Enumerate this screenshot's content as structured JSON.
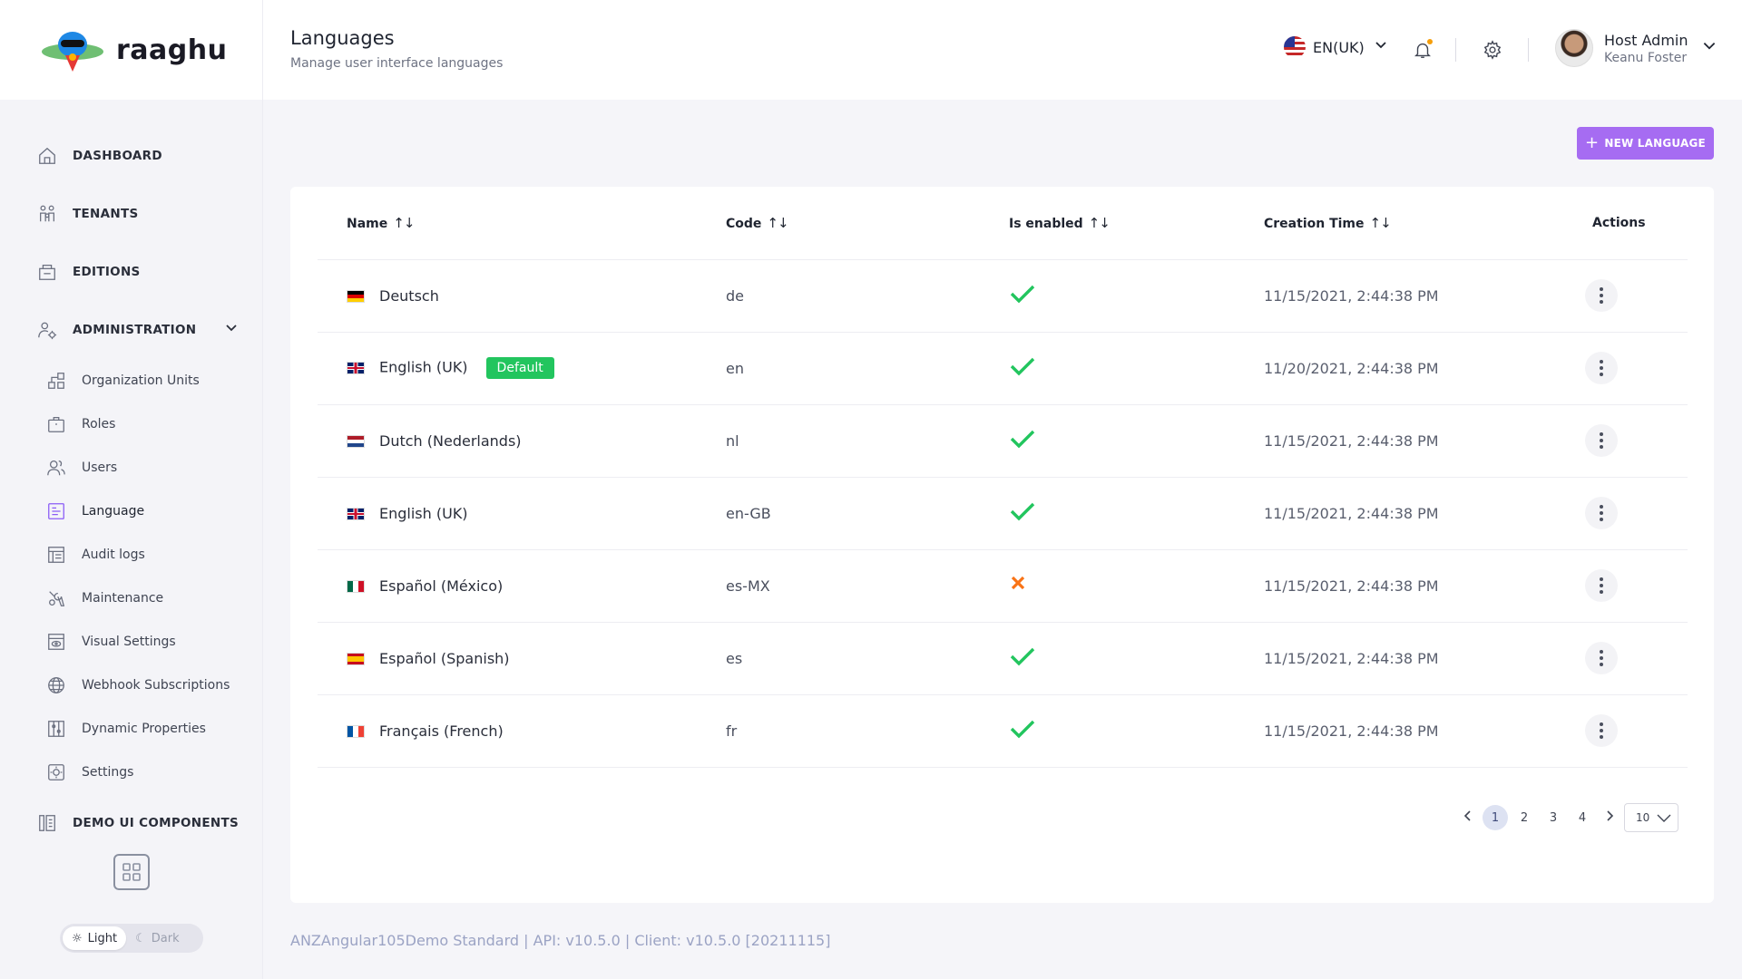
{
  "brand": {
    "name": "raaghu"
  },
  "sidebar": {
    "main": [
      {
        "label": "DASHBOARD",
        "icon": "home-icon"
      },
      {
        "label": "TENANTS",
        "icon": "tenants-icon"
      },
      {
        "label": "EDITIONS",
        "icon": "editions-icon"
      }
    ],
    "admin": {
      "label": "ADMINISTRATION",
      "icon": "admin-icon"
    },
    "sub": [
      {
        "label": "Organization Units",
        "icon": "org-units-icon"
      },
      {
        "label": "Roles",
        "icon": "roles-icon"
      },
      {
        "label": "Users",
        "icon": "users-icon"
      },
      {
        "label": "Language",
        "icon": "language-icon",
        "active": true
      },
      {
        "label": "Audit logs",
        "icon": "audit-logs-icon"
      },
      {
        "label": "Maintenance",
        "icon": "maintenance-icon"
      },
      {
        "label": "Visual Settings",
        "icon": "visual-settings-icon"
      },
      {
        "label": "Webhook Subscriptions",
        "icon": "globe-icon"
      },
      {
        "label": "Dynamic Properties",
        "icon": "dynamic-properties-icon"
      },
      {
        "label": "Settings",
        "icon": "settings-icon"
      }
    ],
    "demo": {
      "label": "DEMO UI COMPONENTS",
      "icon": "components-icon"
    },
    "theme": {
      "light": "Light",
      "dark": "Dark"
    }
  },
  "header": {
    "title": "Languages",
    "subtitle": "Manage user interface languages",
    "language": "EN(UK)",
    "user": {
      "name": "Host Admin",
      "sub": "Keanu Foster"
    }
  },
  "toolbar": {
    "new_language": "NEW LANGUAGE"
  },
  "table": {
    "columns": {
      "name": "Name",
      "code": "Code",
      "enabled": "Is enabled",
      "created": "Creation Time",
      "actions": "Actions"
    },
    "rows": [
      {
        "name": "Deutsch",
        "code": "de",
        "enabled": true,
        "created": "11/15/2021, 2:44:38 PM",
        "flag": "de"
      },
      {
        "name": "English (UK)",
        "badge": "Default",
        "code": "en",
        "enabled": true,
        "created": "11/20/2021, 2:44:38 PM",
        "flag": "gb"
      },
      {
        "name": "Dutch (Nederlands)",
        "code": "nl",
        "enabled": true,
        "created": "11/15/2021, 2:44:38 PM",
        "flag": "nl"
      },
      {
        "name": "English (UK)",
        "code": "en-GB",
        "enabled": true,
        "created": "11/15/2021, 2:44:38 PM",
        "flag": "gb"
      },
      {
        "name": "Español (México)",
        "code": "es-MX",
        "enabled": false,
        "created": "11/15/2021, 2:44:38 PM",
        "flag": "mx"
      },
      {
        "name": "Español (Spanish)",
        "code": "es",
        "enabled": true,
        "created": "11/15/2021, 2:44:38 PM",
        "flag": "es"
      },
      {
        "name": "Français (French)",
        "code": "fr",
        "enabled": true,
        "created": "11/15/2021, 2:44:38 PM",
        "flag": "fr"
      }
    ]
  },
  "pagination": {
    "pages": [
      "1",
      "2",
      "3",
      "4"
    ],
    "current": "1",
    "page_size": "10"
  },
  "colors": {
    "accent": "#a66cf2",
    "enabled": "#22c55e",
    "disabled": "#f97316",
    "badge": "#22c55e"
  },
  "footer": "ANZAngular105Demo Standard | API: v10.5.0 | Client: v10.5.0 [20211115]"
}
